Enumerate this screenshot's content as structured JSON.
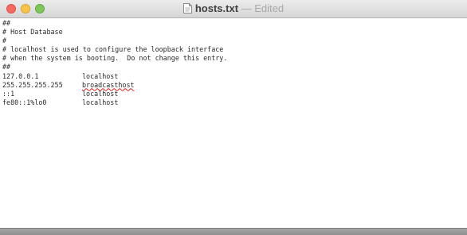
{
  "window": {
    "filename": "hosts.txt",
    "separator": " — ",
    "status": "Edited",
    "icons": {
      "close": "close-button-icon",
      "minimize": "minimize-button-icon",
      "zoom": "zoom-button-icon",
      "document": "text-document-icon"
    },
    "colors": {
      "close": "#f46a61",
      "minimize": "#f8c34a",
      "zoom": "#7fc55a",
      "spellcheck_underline": "#e0201a"
    }
  },
  "editor": {
    "comments": [
      "##",
      "# Host Database",
      "#",
      "# localhost is used to configure the loopback interface",
      "# when the system is booting.  Do not change this entry.",
      "##"
    ],
    "entries": [
      {
        "ip": "127.0.0.1",
        "host": "localhost",
        "misspelled": false
      },
      {
        "ip": "255.255.255.255",
        "host": "broadcasthost",
        "misspelled": true
      },
      {
        "ip": "::1",
        "host": "localhost",
        "misspelled": false
      },
      {
        "ip": "fe80::1%lo0",
        "host": "localhost",
        "misspelled": false
      }
    ]
  }
}
